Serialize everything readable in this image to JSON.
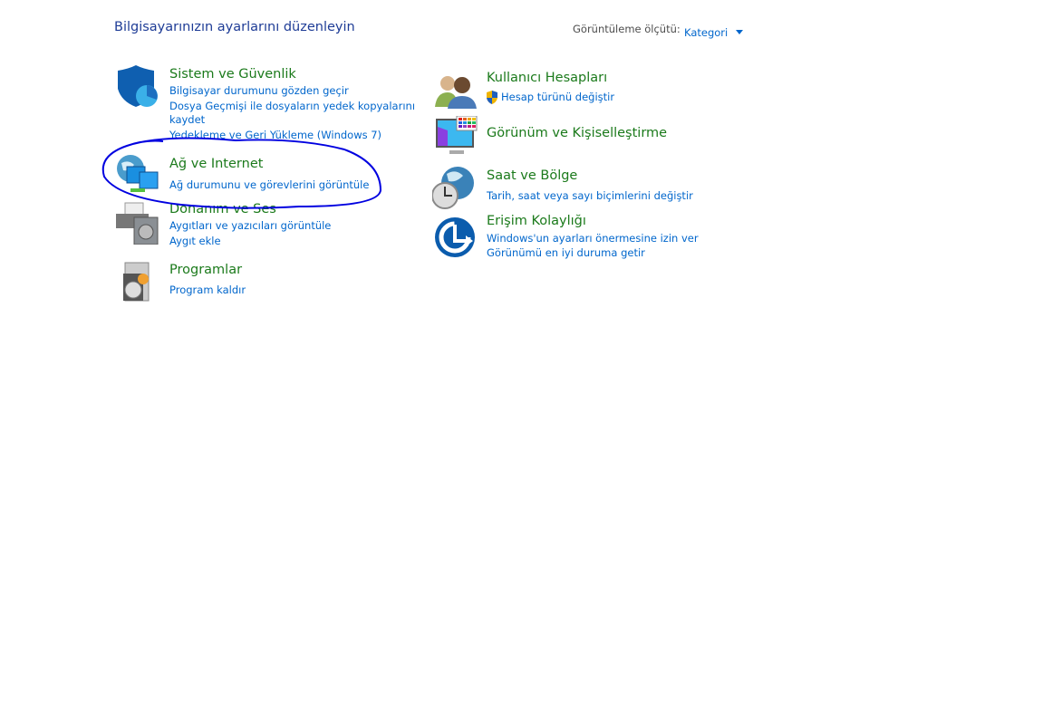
{
  "header": {
    "title": "Bilgisayarınızın ayarlarını düzenleyin",
    "view_by_label": "Görüntüleme ölçütü:",
    "view_by_value": "Kategori"
  },
  "left": [
    {
      "title": "Sistem ve Güvenlik",
      "icon": "shield-icon",
      "links": [
        "Bilgisayar durumunu gözden geçir",
        "Dosya Geçmişi ile dosyaların yedek kopyalarını",
        "kaydet",
        "Yedekleme ve Geri Yükleme (Windows 7)"
      ]
    },
    {
      "title": "Ağ ve Internet",
      "icon": "network-icon",
      "links": [
        "Ağ durumunu ve görevlerini görüntüle"
      ]
    },
    {
      "title": "Donanım ve Ses",
      "icon": "printer-speaker-icon",
      "links": [
        "Aygıtları ve yazıcıları görüntüle",
        "Aygıt ekle"
      ]
    },
    {
      "title": "Programlar",
      "icon": "programs-icon",
      "links": [
        "Program kaldır"
      ]
    }
  ],
  "right": [
    {
      "title": "Kullanıcı Hesapları",
      "icon": "users-icon",
      "links": [
        "Hesap türünü değiştir"
      ]
    },
    {
      "title": "Görünüm ve Kişiselleştirme",
      "icon": "monitor-palette-icon",
      "links": []
    },
    {
      "title": "Saat ve Bölge",
      "icon": "clock-globe-icon",
      "links": [
        "Tarih, saat veya sayı biçimlerini değiştir"
      ]
    },
    {
      "title": "Erişim Kolaylığı",
      "icon": "accessibility-icon",
      "links": [
        "Windows'un ayarları önermesine izin ver",
        "Görünümü en iyi duruma getir"
      ]
    }
  ],
  "colors": {
    "title_green": "#1b7a1b",
    "link_blue": "#0066cc",
    "annotation": "#0000e0"
  }
}
